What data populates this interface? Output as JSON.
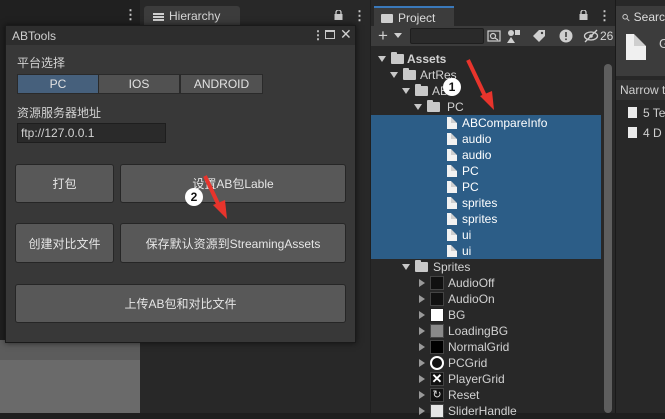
{
  "left_area": {},
  "hierarchy": {
    "tab_label": "Hierarchy"
  },
  "abtools": {
    "title": "ABTools",
    "platform_label": "平台选择",
    "platforms": [
      "PC",
      "IOS",
      "ANDROID"
    ],
    "selected_platform": "PC",
    "server_label": "资源服务器地址",
    "server_value": "ftp://127.0.0.1",
    "btn_pack": "打包",
    "btn_set_label": "设置AB包Lable",
    "btn_create_compare": "创建对比文件",
    "btn_save_default": "保存默认资源到StreamingAssets",
    "btn_upload": "上传AB包和对比文件"
  },
  "project": {
    "tab_label": "Project",
    "toolbar": {
      "count": "26"
    },
    "tree": {
      "assets": "Assets",
      "artres": "ArtRes",
      "ab": "AB",
      "pc": "PC",
      "files": [
        "ABCompareInfo",
        "audio",
        "audio",
        "PC",
        "PC",
        "sprites",
        "sprites",
        "ui",
        "ui"
      ],
      "sprites_folder": "Sprites",
      "sprites": [
        "AudioOff",
        "AudioOn",
        "BG",
        "LoadingBG",
        "NormalGrid",
        "PCGrid",
        "PlayerGrid",
        "Reset",
        "SliderHandle"
      ]
    }
  },
  "inspector": {
    "tab_label": "Searc",
    "g_char": "G",
    "narrow_label": "Narrow t",
    "items": [
      "5 Te",
      "4 D"
    ]
  },
  "annotations": {
    "marker1": "1",
    "marker2": "2",
    "arrow_color": "#e8342c"
  },
  "colors": {
    "selection": "#2c5d87",
    "active_segment": "#46607c",
    "tab_accent": "#3a79bb"
  }
}
